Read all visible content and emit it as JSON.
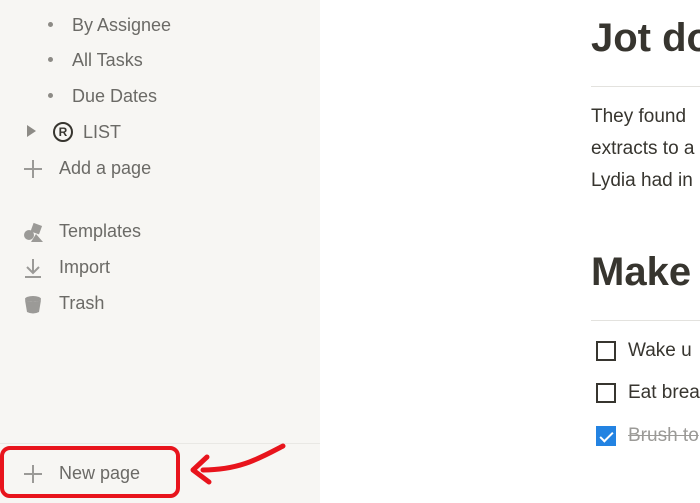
{
  "sidebar": {
    "sub_items": [
      {
        "label": "By Assignee"
      },
      {
        "label": "All Tasks"
      },
      {
        "label": "Due Dates"
      }
    ],
    "list_page": {
      "label": "LIST",
      "icon": "registered-icon",
      "icon_glyph": "R"
    },
    "add_page": {
      "label": "Add a page"
    },
    "actions": [
      {
        "label": "Templates",
        "icon": "templates-icon"
      },
      {
        "label": "Import",
        "icon": "import-icon"
      },
      {
        "label": "Trash",
        "icon": "trash-icon"
      }
    ],
    "new_page": {
      "label": "New page"
    }
  },
  "annotation": {
    "color": "#e8141c"
  },
  "content": {
    "heading1": "Jot do",
    "paragraph_lines": [
      "They found",
      "extracts to a",
      "Lydia had in"
    ],
    "heading2": "Make",
    "todos": [
      {
        "text": "Wake u",
        "checked": false
      },
      {
        "text": "Eat brea",
        "checked": false
      },
      {
        "text": "Brush to",
        "checked": true
      }
    ]
  },
  "colors": {
    "sidebar_bg": "#f7f6f3",
    "checkbox_checked": "#2383e2",
    "text": "#37352f"
  }
}
